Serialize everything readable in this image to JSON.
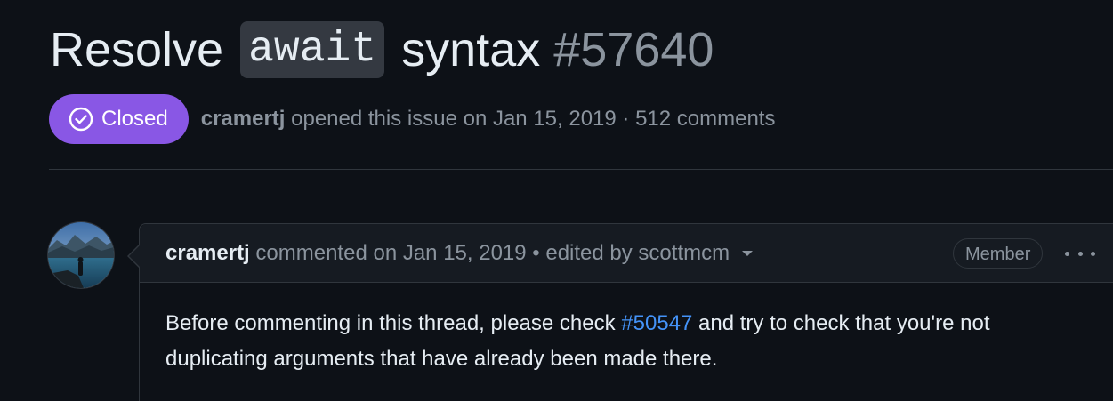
{
  "issue": {
    "title_prefix": "Resolve",
    "title_code": "await",
    "title_suffix": "syntax",
    "number": "#57640"
  },
  "status": {
    "label": "Closed",
    "icon": "check-circle-icon",
    "color": "#8957e5"
  },
  "meta": {
    "author": "cramertj",
    "text": "opened this issue on Jan 15, 2019 · 512 comments"
  },
  "comment": {
    "author": "cramertj",
    "meta": "commented on Jan 15, 2019 • edited by scottmcm",
    "role": "Member",
    "body_before": "Before commenting in this thread, please check",
    "body_link": "#50547",
    "body_after": "and try to check that you're not duplicating arguments that have already been made there."
  },
  "colors": {
    "background": "#0d1117",
    "header": "#161b22",
    "border": "#30363d",
    "link": "#4493f8",
    "muted": "#8b949e"
  }
}
